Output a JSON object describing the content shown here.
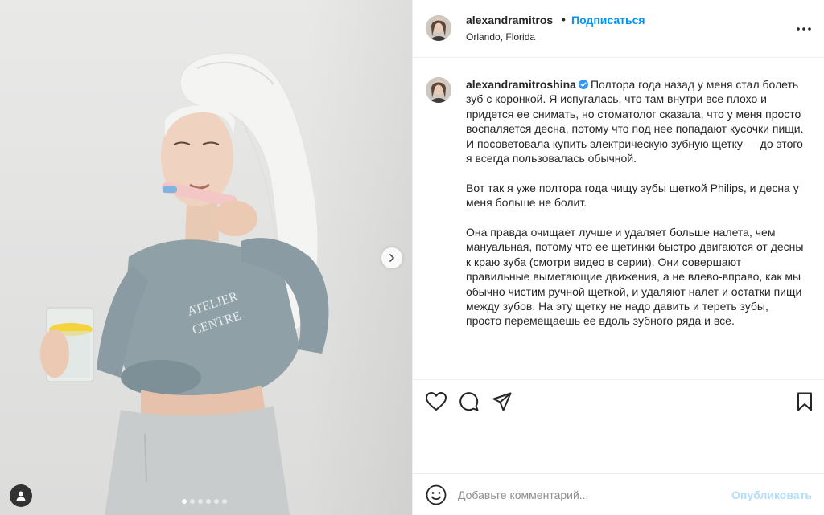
{
  "post_header": {
    "username": "alexandramitros",
    "separator": "•",
    "follow_label": "Подписаться",
    "location": "Orlando, Florida",
    "more_icon": "more-horizontal-icon"
  },
  "caption": {
    "username": "alexandramitroshina",
    "verified_icon": "verified-badge-icon",
    "paragraphs": [
      "Полтора года назад у меня стал болеть зуб с коронкой. Я испугалась, что там внутри все плохо и придется ее снимать, но стоматолог сказала, что у меня просто воспаляется десна, потому что под нее попадают кусочки пищи. И посоветовала купить электрическую зубную щетку — до этого я всегда пользовалась обычной.",
      "Вот так я уже полтора года чищу зубы щеткой Philips, и десна у меня больше не болит.",
      "Она правда очищает лучше и удаляет больше налета, чем мануальная, потому что ее щетинки быстро двигаются от десны к краю зуба (смотри видео в серии). Они совершают правильные выметающие движения, а не влево-вправо, как мы обычно чистим ручной щеткой, и удаляют налет и остатки пищи между зубов.  На эту щетку не надо давить и тереть зубы, просто перемещаешь ее вдоль зубного ряда и все."
    ]
  },
  "actions": {
    "like_icon": "heart-icon",
    "comment_icon": "comment-icon",
    "share_icon": "share-icon",
    "save_icon": "bookmark-icon"
  },
  "comment_box": {
    "placeholder": "Добавьте комментарий...",
    "value": "",
    "publish_label": "Опубликовать",
    "emoji_icon": "emoji-icon"
  },
  "carousel": {
    "slide_count": 6,
    "active_index": 0,
    "next_icon": "chevron-right-icon",
    "tag_icon": "user-tag-icon"
  },
  "colors": {
    "accent": "#0095f6",
    "publish_disabled": "#b2dffc",
    "text": "#262626",
    "secondary_text": "#8e8e8e",
    "divider": "#efefef"
  }
}
